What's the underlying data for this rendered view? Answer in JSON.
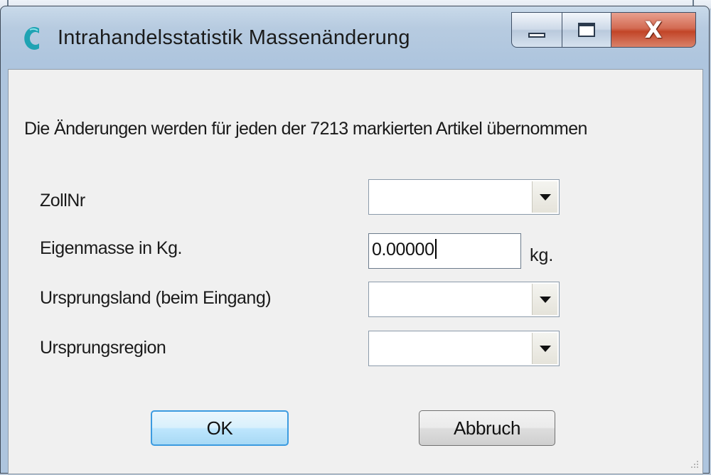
{
  "window": {
    "title": "Intrahandelsstatistik Massenänderung",
    "close_glyph": "X"
  },
  "dialog": {
    "message": "Die Änderungen werden für jeden der 7213 markierten Artikel übernommen",
    "fields": {
      "zollnr": {
        "label": "ZollNr",
        "value": ""
      },
      "eigenmasse": {
        "label": "Eigenmasse in Kg.",
        "value": "0.00000",
        "unit": "kg."
      },
      "ursprungsland": {
        "label": "Ursprungsland (beim Eingang)",
        "value": ""
      },
      "ursprungsregion": {
        "label": "Ursprungsregion",
        "value": ""
      }
    },
    "ok_label": "OK",
    "cancel_label": "Abbruch"
  },
  "icons": [
    "app-c-icon",
    "minimize-icon",
    "maximize-icon",
    "close-icon",
    "dropdown-arrow-icon",
    "resize-grip-icon"
  ],
  "colors": {
    "accent": "#3c9be0",
    "close_button": "#c24528",
    "client_bg": "#f0f0f0",
    "app_icon": "#1fa3b3"
  }
}
